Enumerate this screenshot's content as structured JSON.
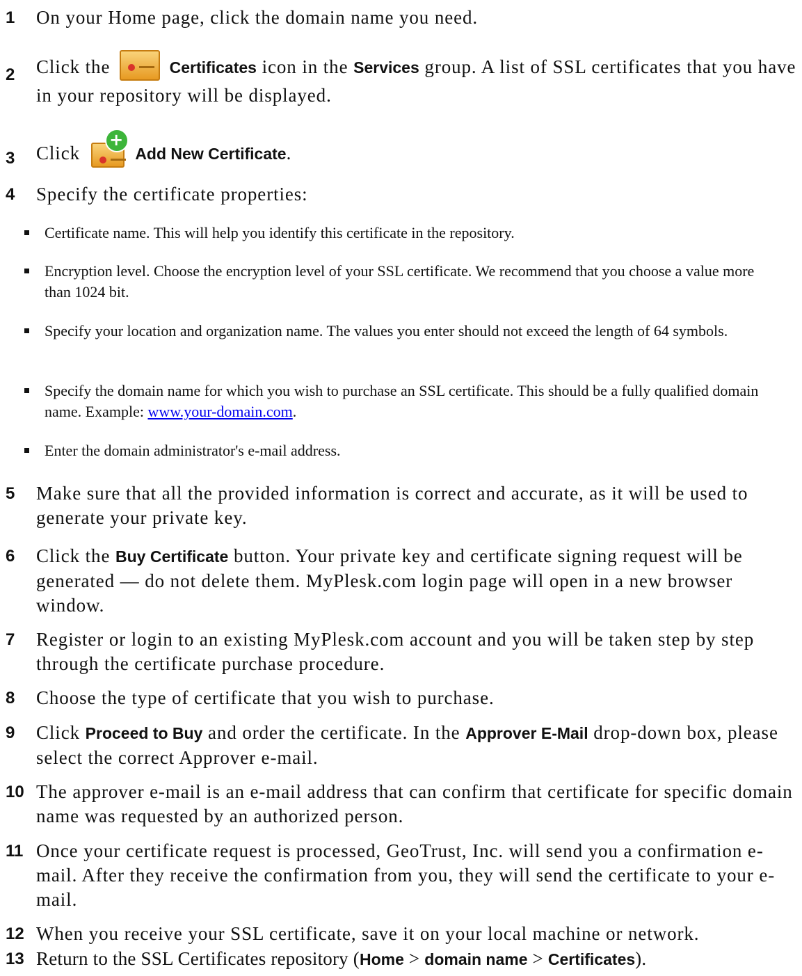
{
  "steps": {
    "s1": {
      "num": "1",
      "text": "On your Home page, click the domain name you need."
    },
    "s2": {
      "num": "2",
      "t1": "Click the",
      "certificates": "Certificates",
      "t2": "icon in the",
      "services": "Services",
      "t3": "group. A list of SSL certificates that you have in your repository will be displayed."
    },
    "s3": {
      "num": "3",
      "t1": "Click",
      "add_new": "Add New Certificate",
      "t2": "."
    },
    "s4": {
      "num": "4",
      "text": "Specify the certificate properties:",
      "bullets": [
        "Certificate name. This will help you identify this certificate in the repository.",
        "Encryption level. Choose the encryption level of your SSL certificate. We recommend that you choose a value more than 1024 bit.",
        "Specify your location and organization name. The values you enter should not exceed the length of 64 symbols.",
        "Specify the domain name for which you wish to purchase an SSL certificate. This should be a fully qualified domain name. Example:",
        "Enter the domain administrator's e-mail address."
      ],
      "example_link": "www.your-domain.com",
      "link_suffix": "."
    },
    "s5": {
      "num": "5",
      "text": "Make sure that all the provided information is correct and accurate, as it will be used to generate your private key."
    },
    "s6": {
      "num": "6",
      "t1": "Click the",
      "buy": "Buy Certificate",
      "t2": "button. Your private key and certificate signing request will be generated — do not delete them. MyPlesk.com login page will open in a new browser window."
    },
    "s7": {
      "num": "7",
      "text": "Register or login to an existing MyPlesk.com account and you will be taken step by step through the certificate purchase procedure."
    },
    "s8": {
      "num": "8",
      "text": "Choose the type of certificate that you wish to purchase."
    },
    "s9": {
      "num": "9",
      "t1": "Click",
      "proceed": "Proceed to Buy",
      "t2": "and order the certificate. In the",
      "approver": "Approver E-Mail",
      "t3": "drop-down box, please select the correct Approver e-mail."
    },
    "s10": {
      "num": "10",
      "text": "The approver e-mail is an e-mail address that can confirm that certificate for specific domain name was requested by an authorized person."
    },
    "s11": {
      "num": "11",
      "text": "Once your certificate request is processed, GeoTrust, Inc. will send you a confirmation e-mail. After they receive the confirmation from you, they will send the certificate to your e-mail."
    },
    "s12": {
      "num": "12",
      "text": "When you receive your SSL certificate, save it on your local machine or network."
    },
    "s13": {
      "num": "13",
      "t1": "Return to the SSL Certificates repository (",
      "home": "Home",
      "gt1": ">",
      "domain": "domain name",
      "gt2": ">",
      "certs": "Certificates",
      "t2": ")."
    }
  },
  "icons": {
    "certificate": "certificate-icon",
    "add_certificate": "add-certificate-icon"
  }
}
